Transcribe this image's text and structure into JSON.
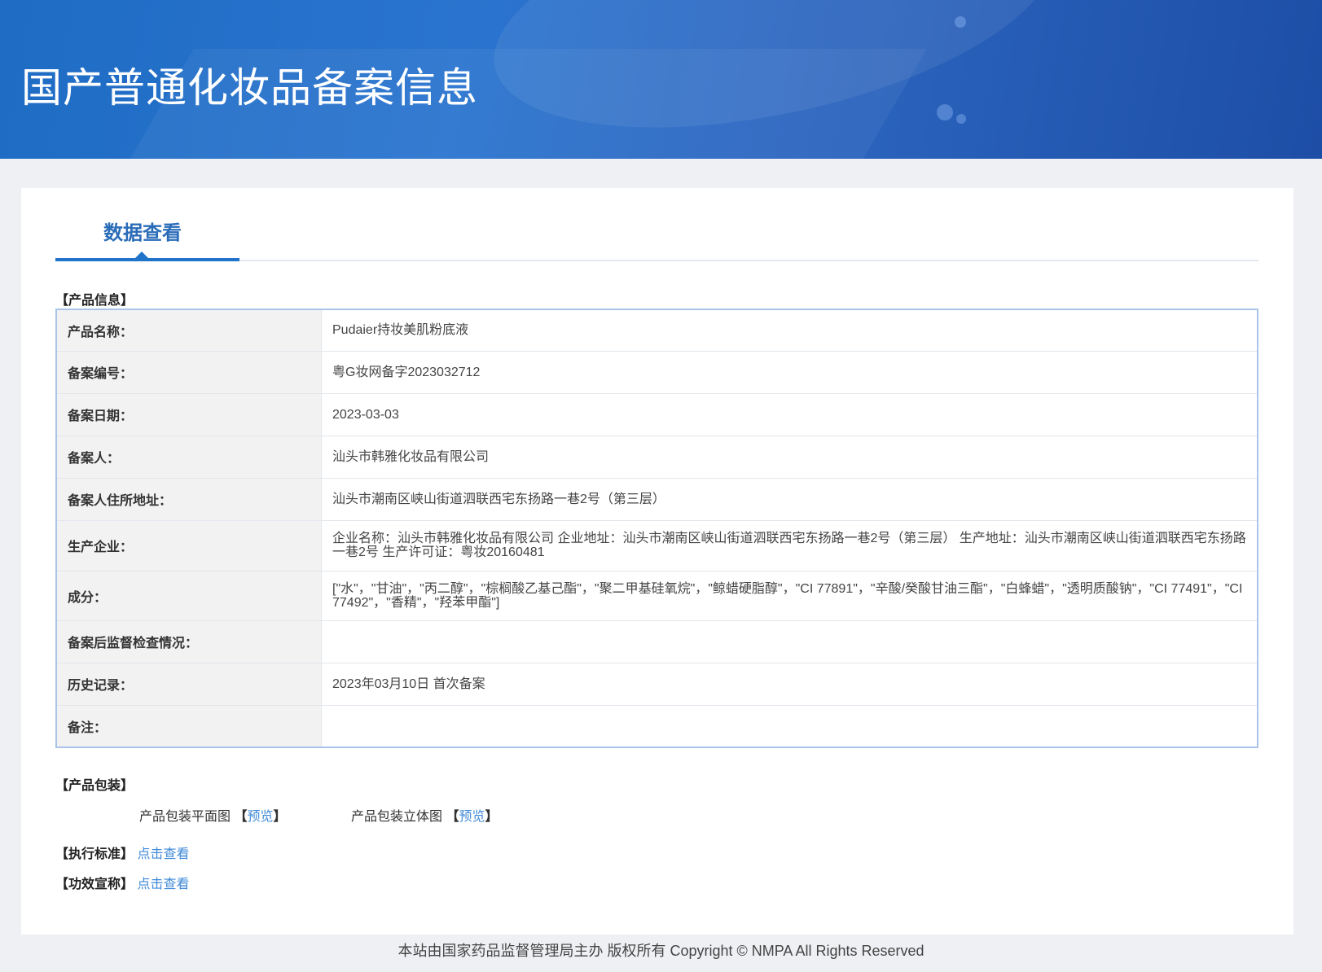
{
  "header": {
    "title": "国产普通化妆品备案信息"
  },
  "tab": {
    "label": "数据查看"
  },
  "product_info": {
    "section_title": "【产品信息】",
    "rows": [
      {
        "label": "产品名称：",
        "value": "Pudaier持妆美肌粉底液"
      },
      {
        "label": "备案编号：",
        "value": "粤G妆网备字2023032712"
      },
      {
        "label": "备案日期：",
        "value": "2023-03-03"
      },
      {
        "label": "备案人：",
        "value": "汕头市韩雅化妆品有限公司"
      },
      {
        "label": "备案人住所地址：",
        "value": "汕头市潮南区峡山街道泗联西宅东扬路一巷2号（第三层）"
      },
      {
        "label": "生产企业：",
        "value": "企业名称：汕头市韩雅化妆品有限公司 企业地址：汕头市潮南区峡山街道泗联西宅东扬路一巷2号（第三层） 生产地址：汕头市潮南区峡山街道泗联西宅东扬路一巷2号 生产许可证：粤妆20160481"
      },
      {
        "label": "成分：",
        "value": "[\"水\"，\"甘油\"，\"丙二醇\"，\"棕榈酸乙基己酯\"，\"聚二甲基硅氧烷\"，\"鲸蜡硬脂醇\"，\"CI 77891\"，\"辛酸/癸酸甘油三酯\"，\"白蜂蜡\"，\"透明质酸钠\"，\"CI 77491\"，\"CI 77492\"，\"香精\"，\"羟苯甲酯\"]"
      },
      {
        "label": "备案后监督检查情况：",
        "value": ""
      },
      {
        "label": "历史记录：",
        "value": "2023年03月10日 首次备案"
      },
      {
        "label": "备注：",
        "value": ""
      }
    ]
  },
  "packaging": {
    "section_title": "【产品包装】",
    "flat_label": "产品包装平面图",
    "solid_label": "产品包装立体图",
    "bracket_open": "【",
    "bracket_close": "】",
    "preview_link": "预览"
  },
  "standard": {
    "section_title": "【执行标准】",
    "link": "点击查看"
  },
  "efficacy": {
    "section_title": "【功效宣称】",
    "link": "点击查看"
  },
  "footer": {
    "text": "本站由国家药品监督管理局主办 版权所有 Copyright © NMPA All Rights Reserved"
  }
}
